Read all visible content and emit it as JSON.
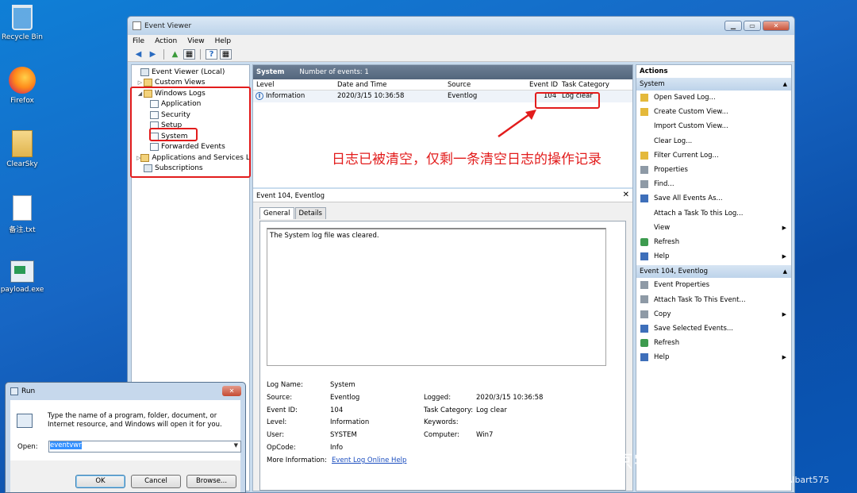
{
  "desktop": {
    "icons": [
      {
        "label": "Recycle Bin",
        "icon": "recycle-bin-icon"
      },
      {
        "label": "Firefox",
        "icon": "firefox-icon"
      },
      {
        "label": "ClearSky",
        "icon": "folder-icon"
      },
      {
        "label": "备注.txt",
        "icon": "text-file-icon"
      },
      {
        "label": "payload.exe",
        "icon": "exe-icon"
      }
    ]
  },
  "window": {
    "title": "Event Viewer",
    "controls": {
      "minimize": "▁",
      "maximize": "▭",
      "close": "✕"
    },
    "menu": [
      "File",
      "Action",
      "View",
      "Help"
    ],
    "toolbar": {
      "back": "◀",
      "forward": "▶",
      "up": "▲",
      "grid": "▦",
      "help": "?",
      "grid2": "▦"
    }
  },
  "tree": {
    "items": [
      {
        "label": "Event Viewer (Local)",
        "twisty": "",
        "icon": "event-viewer-icon"
      },
      {
        "label": "Custom Views",
        "twisty": "▷",
        "icon": "folder-icon"
      },
      {
        "label": "Windows Logs",
        "twisty": "◢",
        "icon": "folder-icon"
      },
      {
        "label": "Application",
        "twisty": "",
        "icon": "log-icon"
      },
      {
        "label": "Security",
        "twisty": "",
        "icon": "log-icon"
      },
      {
        "label": "Setup",
        "twisty": "",
        "icon": "log-icon"
      },
      {
        "label": "System",
        "twisty": "",
        "icon": "log-icon"
      },
      {
        "label": "Forwarded Events",
        "twisty": "",
        "icon": "log-icon"
      },
      {
        "label": "Applications and Services Lo",
        "twisty": "▷",
        "icon": "folder-icon"
      },
      {
        "label": "Subscriptions",
        "twisty": "",
        "icon": "subscriptions-icon"
      }
    ]
  },
  "events": {
    "header_title": "System",
    "header_count": "Number of events: 1",
    "columns": [
      "Level",
      "Date and Time",
      "Source",
      "Event ID",
      "Task Category"
    ],
    "rows": [
      {
        "level": "Information",
        "datetime": "2020/3/15 10:36:58",
        "source": "Eventlog",
        "event_id": "104",
        "task_category": "Log clear"
      }
    ]
  },
  "detail": {
    "title": "Event 104, Eventlog",
    "close": "✕",
    "tabs": [
      "General",
      "Details"
    ],
    "message": "The System log file was cleared.",
    "props_left": [
      {
        "label": "Log Name:",
        "value": "System"
      },
      {
        "label": "Source:",
        "value": "Eventlog"
      },
      {
        "label": "Event ID:",
        "value": "104"
      },
      {
        "label": "Level:",
        "value": "Information"
      },
      {
        "label": "User:",
        "value": "SYSTEM"
      },
      {
        "label": "OpCode:",
        "value": "Info"
      },
      {
        "label": "More Information:",
        "value": "Event Log Online Help"
      }
    ],
    "props_right": [
      {
        "label": "Logged:",
        "value": "2020/3/15 10:36:58"
      },
      {
        "label": "Task Category:",
        "value": "Log clear"
      },
      {
        "label": "Keywords:",
        "value": ""
      },
      {
        "label": "Computer:",
        "value": "Win7"
      }
    ]
  },
  "actions": {
    "title": "Actions",
    "section1": {
      "title": "System",
      "items": [
        {
          "label": "Open Saved Log...",
          "icon": "open-log-icon",
          "arrow": ""
        },
        {
          "label": "Create Custom View...",
          "icon": "filter-icon",
          "arrow": ""
        },
        {
          "label": "Import Custom View...",
          "icon": "",
          "arrow": ""
        },
        {
          "label": "Clear Log...",
          "icon": "",
          "arrow": ""
        },
        {
          "label": "Filter Current Log...",
          "icon": "filter-icon",
          "arrow": ""
        },
        {
          "label": "Properties",
          "icon": "properties-icon",
          "arrow": ""
        },
        {
          "label": "Find...",
          "icon": "find-icon",
          "arrow": ""
        },
        {
          "label": "Save All Events As...",
          "icon": "save-icon",
          "arrow": ""
        },
        {
          "label": "Attach a Task To this Log...",
          "icon": "",
          "arrow": ""
        },
        {
          "label": "View",
          "icon": "",
          "arrow": "▶"
        },
        {
          "label": "Refresh",
          "icon": "refresh-icon",
          "arrow": ""
        },
        {
          "label": "Help",
          "icon": "help-icon",
          "arrow": "▶"
        }
      ]
    },
    "section2": {
      "title": "Event 104, Eventlog",
      "items": [
        {
          "label": "Event Properties",
          "icon": "properties-icon",
          "arrow": ""
        },
        {
          "label": "Attach Task To This Event...",
          "icon": "task-icon",
          "arrow": ""
        },
        {
          "label": "Copy",
          "icon": "copy-icon",
          "arrow": "▶"
        },
        {
          "label": "Save Selected Events...",
          "icon": "save-icon",
          "arrow": ""
        },
        {
          "label": "Refresh",
          "icon": "refresh-icon",
          "arrow": ""
        },
        {
          "label": "Help",
          "icon": "help-icon",
          "arrow": "▶"
        }
      ]
    }
  },
  "run_dialog": {
    "title": "Run",
    "close": "✕",
    "description": "Type the name of a program, folder, document, or Internet resource, and Windows will open it for you.",
    "open_label": "Open:",
    "input_value": "eventvwr",
    "dropdown": "▼",
    "buttons": {
      "ok": "OK",
      "cancel": "Cancel",
      "browse": "Browse..."
    }
  },
  "annotation": {
    "note": "日志已被清空，仅剩一条清空日志的操作记录",
    "color": "#e21c1c"
  },
  "watermark": {
    "zhihu": "知乎 @北京学神IT教育机构",
    "csdn": "CSDN @Albart575"
  }
}
